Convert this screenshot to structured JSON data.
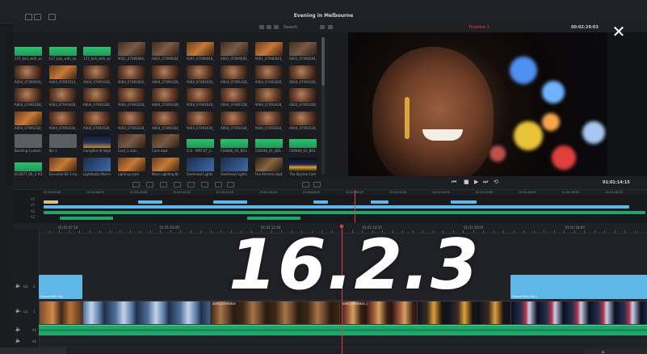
{
  "window": {
    "title": "Evening in Melbourne"
  },
  "media_pool": {
    "search_label": "Search",
    "clips": [
      {
        "label": "137_bali_with_wi...",
        "thumb": "wave"
      },
      {
        "label": "137_bali_with_wi...",
        "thumb": "wave"
      },
      {
        "label": "137_bali_with_wi...",
        "thumb": "wave"
      },
      {
        "label": "A001_07080844_C...",
        "thumb": "dark"
      },
      {
        "label": "A001_07090644_C...",
        "thumb": "dark"
      },
      {
        "label": "A001_07090644_C...",
        "thumb": "warm"
      },
      {
        "label": "A001_07090644_C...",
        "thumb": "dark"
      },
      {
        "label": "A001_07090644_C...",
        "thumb": "warm"
      },
      {
        "label": "A001_07090644_C...",
        "thumb": "dark"
      },
      {
        "label": "A004_07090616_C...",
        "thumb": "skin"
      },
      {
        "label": "A004_07091613_C...",
        "thumb": "warm"
      },
      {
        "label": "A004_07091618_C...",
        "thumb": "skin"
      },
      {
        "label": "A004_07091626_C...",
        "thumb": "skin"
      },
      {
        "label": "A004_07091626_C...",
        "thumb": "skin"
      },
      {
        "label": "A004_07091626_C...",
        "thumb": "skin"
      },
      {
        "label": "A004_07091626_C...",
        "thumb": "skin"
      },
      {
        "label": "A004_07091626_C...",
        "thumb": "skin"
      },
      {
        "label": "A004_07091626_C...",
        "thumb": "skin"
      },
      {
        "label": "A004_07091628_C...",
        "thumb": "skin"
      },
      {
        "label": "A004_07091628_C...",
        "thumb": "skin"
      },
      {
        "label": "A004_07091628_C...",
        "thumb": "skin"
      },
      {
        "label": "A004_07091628_C...",
        "thumb": "skin"
      },
      {
        "label": "A004_07091628_C...",
        "thumb": "skin"
      },
      {
        "label": "A004_07091628_C...",
        "thumb": "skin"
      },
      {
        "label": "A004_07091628_C...",
        "thumb": "skin"
      },
      {
        "label": "A004_07091628_C...",
        "thumb": "skin"
      },
      {
        "label": "A004_07091628_C...",
        "thumb": "skin"
      },
      {
        "label": "A004_07091634_C...",
        "thumb": "warm"
      },
      {
        "label": "A004_07091634_C...",
        "thumb": "skin"
      },
      {
        "label": "A004_07091634_C...",
        "thumb": "skin"
      },
      {
        "label": "A004_07091634_C...",
        "thumb": "skin"
      },
      {
        "label": "A004_07091634_C...",
        "thumb": "skin"
      },
      {
        "label": "A004_07091634_C...",
        "thumb": "skin"
      },
      {
        "label": "A004_07091634_C...",
        "thumb": "skin"
      },
      {
        "label": "A004_07091634_C...",
        "thumb": "skin"
      },
      {
        "label": "A004_07091634_C...",
        "thumb": "skin"
      },
      {
        "label": "Building Custom...",
        "thumb": "gray"
      },
      {
        "label": "Bin 1",
        "thumb": "gray"
      },
      {
        "label": "Campfire At Night...",
        "thumb": "night"
      },
      {
        "label": "Card_1.mpn",
        "thumb": "dark"
      },
      {
        "label": "Card.mp4",
        "thumb": "dark"
      },
      {
        "label": "CLS - WRT-ET_C...",
        "thumb": "wave"
      },
      {
        "label": "CS0046_01_B01...",
        "thumb": "wave"
      },
      {
        "label": "CS0046_01_B01...",
        "thumb": "wave"
      },
      {
        "label": "CS0046_01_B01...",
        "thumb": "wave"
      },
      {
        "label": "ECS677_06_3 #5...",
        "thumb": "wave"
      },
      {
        "label": "Essential Elt 1.mp4",
        "thumb": "warm"
      },
      {
        "label": "Lightbulbs Moving...",
        "thumb": "blue"
      },
      {
        "label": "Lighting.mp4",
        "thumb": "warm"
      },
      {
        "label": "Moss Lighting Br...",
        "thumb": "warm"
      },
      {
        "label": "Overhead Lights F...",
        "thumb": "blue"
      },
      {
        "label": "Overhead Lights...",
        "thumb": "blue"
      },
      {
        "label": "The Kitchen.mp4",
        "thumb": "kitchen"
      },
      {
        "label": "The Skyline Cam 4...",
        "thumb": "city"
      }
    ]
  },
  "viewer": {
    "timeline_name": "Timeline 1",
    "timecode": "00:02:29:03",
    "playback_timecode": "01:01:14:15",
    "controls": [
      "prev-icon",
      "stop-icon",
      "play-icon",
      "next-icon",
      "loop-icon"
    ]
  },
  "mini_timeline": {
    "ruler": [
      "01:00:00:00",
      "01:00:08:00",
      "01:00:16:00",
      "01:00:24:00",
      "01:00:32:00",
      "01:00:40:00",
      "01:00:48:00",
      "01:00:56:00",
      "01:01:04:00",
      "01:01:12:00",
      "01:01:20:00",
      "01:01:28:00",
      "01:01:36:00",
      "01:01:44:00"
    ],
    "tracks": [
      "V2",
      "V1",
      "A1",
      "A2"
    ]
  },
  "timeline": {
    "ruler": [
      "01:01:07:16",
      "01:01:10:00",
      "01:01:12:00",
      "01:01:14:15",
      "01:01:16:00",
      "01:01:18:00"
    ],
    "tracks": [
      {
        "id": "V2",
        "label": "2"
      },
      {
        "id": "V1",
        "label": "1"
      },
      {
        "id": "A1",
        "label": "A1"
      },
      {
        "id": "A2",
        "label": "A2"
      }
    ],
    "clip_names": [
      "Hazard Bell Clip",
      "A004_07091628",
      "A004_07091628_C",
      "Hazard Bell Clip 2"
    ]
  },
  "version_text": "16.2.3",
  "colors": {
    "accent_red": "#e0403b",
    "video_clip": "#5fb7e8",
    "audio_clip": "#1fa76a",
    "panel": "#1b1c20"
  }
}
